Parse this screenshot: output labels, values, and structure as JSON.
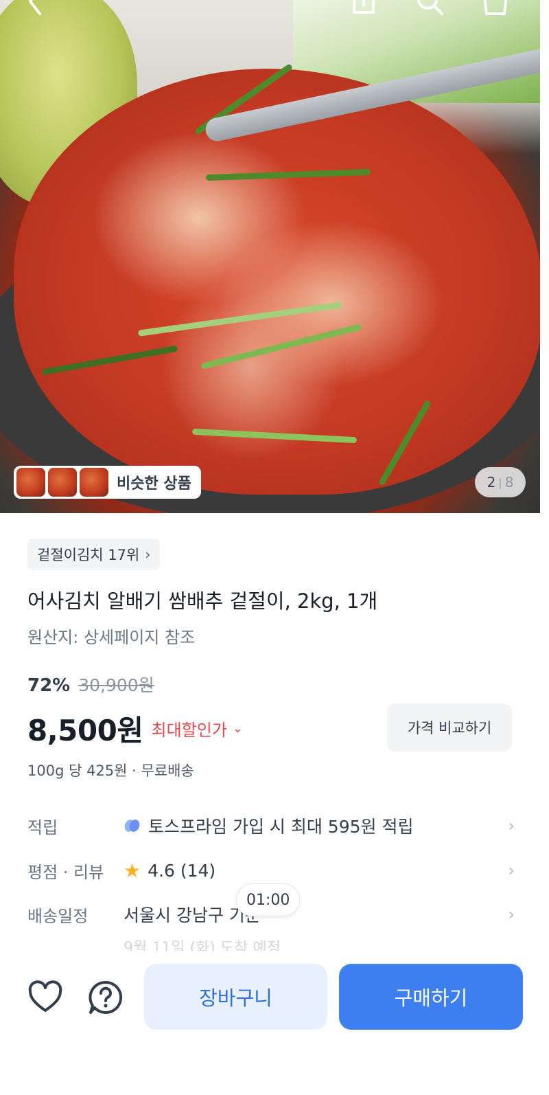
{
  "gallery": {
    "similar_label": "비슷한 상품",
    "page_current": "2",
    "page_separator": "|",
    "page_total": "8"
  },
  "product": {
    "rank_badge": "겉절이김치 17위",
    "title": "어사김치 알배기 쌈배추 겉절이, 2kg, 1개",
    "origin": "원산지: 상세페이지 참조",
    "discount_rate": "72%",
    "original_price": "30,900원",
    "price": "8,500원",
    "max_discount_label": "최대할인가",
    "compare_button": "가격 비교하기",
    "unit_price": "100g 당 425원 · 무료배송"
  },
  "info": {
    "points_label": "적립",
    "points_value": "토스프라임 가입 시 최대 595원 적립",
    "rating_label": "평점 · 리뷰",
    "rating_value": "4.6 (14)",
    "delivery_label": "배송일정",
    "delivery_value": "서울시 강남구 기준",
    "delivery_sub": "9월 11일 (화) 도착 예정"
  },
  "timer": "01:00",
  "actions": {
    "cart_label": "장바구니",
    "buy_label": "구매하기"
  },
  "icons": {
    "back": "back-arrow-icon",
    "share": "share-icon",
    "search": "search-icon",
    "cart": "shopping-bag-icon",
    "wishlist": "heart-icon",
    "inquiry": "question-icon",
    "star": "star-icon",
    "prime": "toss-prime-icon"
  },
  "colors": {
    "primary": "#3d7ff0",
    "primary_light": "#e8f0fd",
    "discount_red": "#e5484d",
    "star": "#f5b324"
  }
}
